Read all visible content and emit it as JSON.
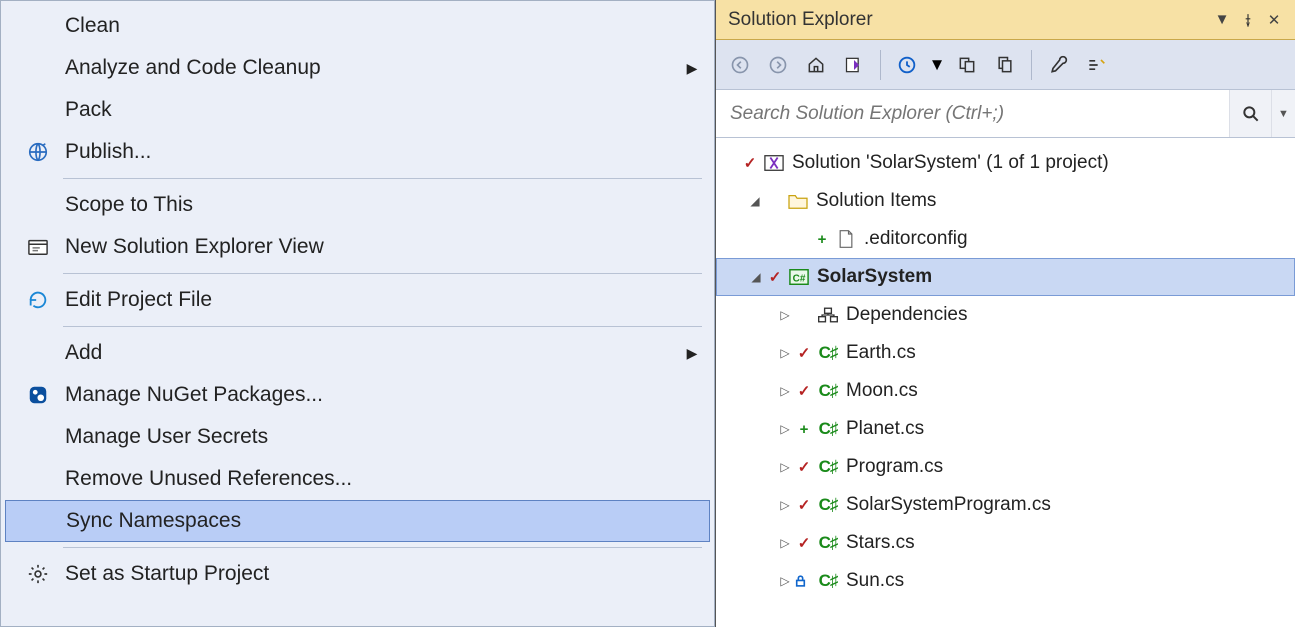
{
  "menu": {
    "clean": "Clean",
    "analyze": "Analyze and Code Cleanup",
    "pack": "Pack",
    "publish": "Publish...",
    "scope": "Scope to This",
    "newView": "New Solution Explorer View",
    "editProject": "Edit Project File",
    "add": "Add",
    "nuget": "Manage NuGet Packages...",
    "secrets": "Manage User Secrets",
    "removeRefs": "Remove Unused References...",
    "syncNs": "Sync Namespaces",
    "startup": "Set as Startup Project"
  },
  "explorer": {
    "title": "Solution Explorer",
    "searchPlaceholder": "Search Solution Explorer (Ctrl+;)",
    "solution": "Solution 'SolarSystem' (1 of 1 project)",
    "solutionItems": "Solution Items",
    "editorconfig": ".editorconfig",
    "project": "SolarSystem",
    "deps": "Dependencies",
    "files": [
      {
        "name": "Earth.cs",
        "status": "check"
      },
      {
        "name": "Moon.cs",
        "status": "check"
      },
      {
        "name": "Planet.cs",
        "status": "plus"
      },
      {
        "name": "Program.cs",
        "status": "check"
      },
      {
        "name": "SolarSystemProgram.cs",
        "status": "check"
      },
      {
        "name": "Stars.cs",
        "status": "check"
      },
      {
        "name": "Sun.cs",
        "status": "lock"
      }
    ]
  }
}
